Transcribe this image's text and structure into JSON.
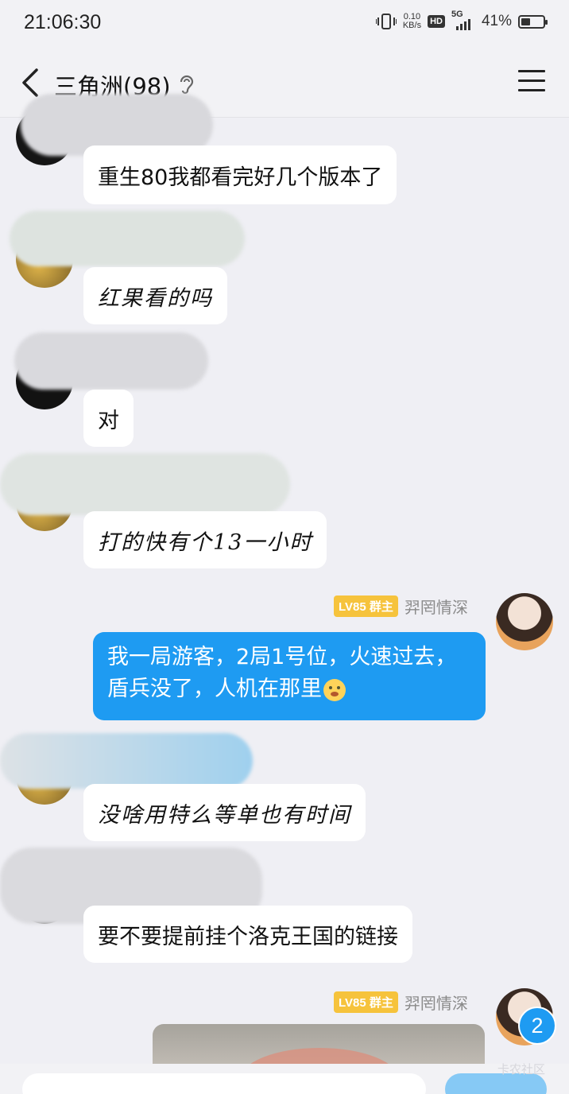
{
  "status": {
    "time": "21:06:30",
    "net_speed": "0.10",
    "net_unit": "KB/s",
    "hd": "HD",
    "network": "5G",
    "battery": "41%",
    "battery_level": 0.41
  },
  "header": {
    "title": "三角洲(98)",
    "back_icon": "back-arrow-icon",
    "ear_icon": "ear-icon",
    "menu_icon": "menu-icon"
  },
  "messages": [
    {
      "side": "left",
      "text": "重生80我都看完好几个版本了"
    },
    {
      "side": "left",
      "text": "红果看的吗"
    },
    {
      "side": "left",
      "text": "对"
    },
    {
      "side": "left",
      "text": "打的快有个13一小时"
    },
    {
      "side": "right",
      "level": "LV85 群主",
      "sender": "羿罔情深",
      "text": "我一局游客，2局1号位，火速过去，盾兵没了，人机在那里"
    },
    {
      "side": "left",
      "text": "没啥用特么等单也有时间"
    },
    {
      "side": "left",
      "text": "要不要提前挂个洛克王国的链接"
    },
    {
      "side": "right",
      "level": "LV85 群主",
      "sender": "羿罔情深",
      "type": "image"
    }
  ],
  "unread_badge": "2",
  "watermark": "卡农社区",
  "colors": {
    "outgoing_bubble": "#1e9bf2",
    "incoming_bubble": "#ffffff",
    "background": "#efeff4",
    "level_badge": "#f6c33c"
  }
}
